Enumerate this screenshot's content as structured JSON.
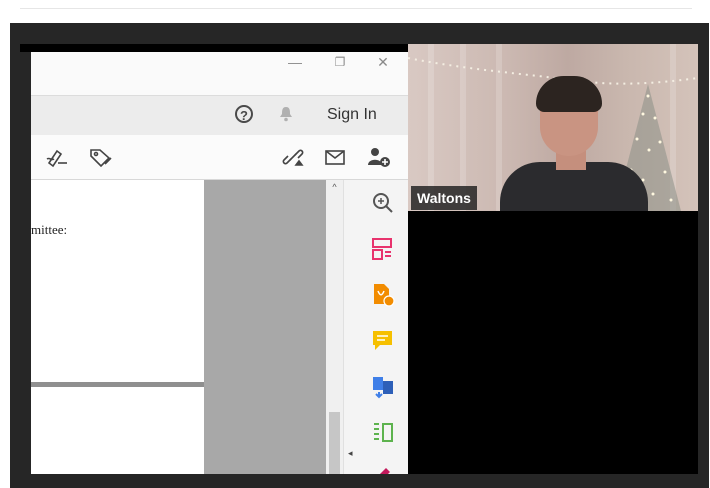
{
  "pdf_app": {
    "window_controls": {
      "minimize": "—",
      "restore": "❐",
      "close": "✕"
    },
    "menubar": {
      "help_label": "?",
      "sign_in_label": "Sign In"
    },
    "toolbar_icons": [
      "sign-pen-icon",
      "stamp-tag-icon",
      "link-icon",
      "mail-icon",
      "add-user-icon"
    ],
    "document": {
      "visible_text": "mittee:"
    },
    "scrollbar": {
      "up_arrow": "^",
      "side_arrow": "◂"
    },
    "right_panel_icons": [
      {
        "name": "zoom-icon",
        "color": "#555555"
      },
      {
        "name": "organize-pages-icon",
        "color": "#e8336d"
      },
      {
        "name": "export-pdf-icon",
        "color": "#f28c00"
      },
      {
        "name": "comment-icon",
        "color": "#f6c000"
      },
      {
        "name": "combine-files-icon",
        "color": "#3f7fe8"
      },
      {
        "name": "compare-icon",
        "color": "#5db34e"
      }
    ]
  },
  "video": {
    "participant_name": "Waltons"
  }
}
